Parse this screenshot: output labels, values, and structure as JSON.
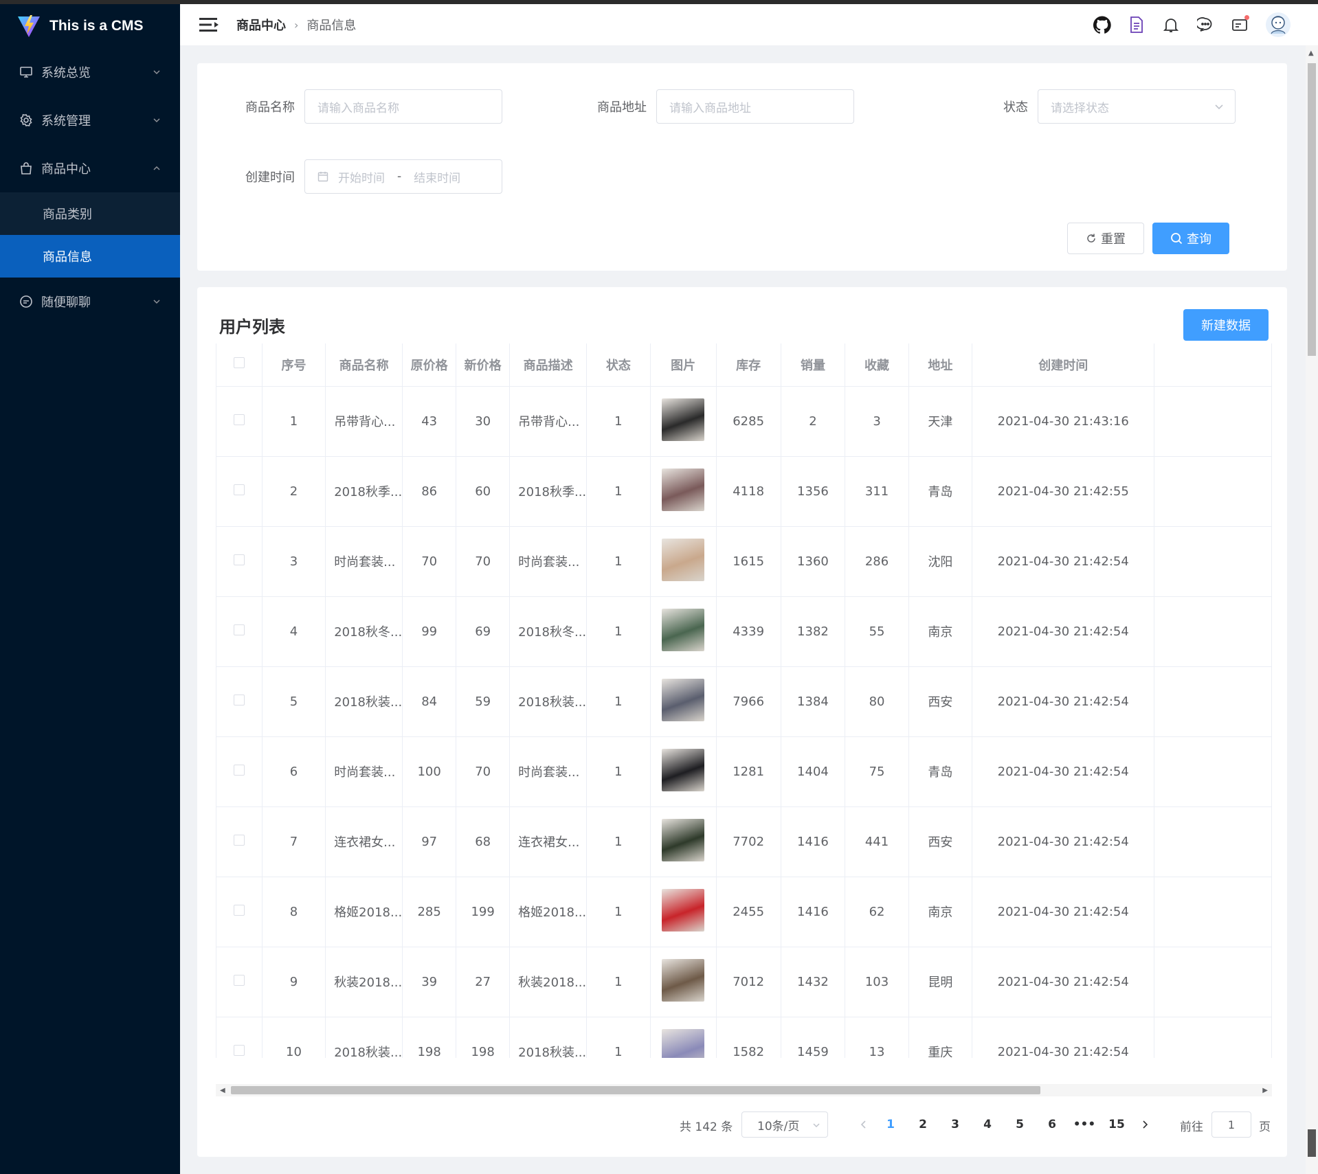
{
  "app": {
    "title": "This is a CMS",
    "brand_color": "#409eff",
    "sidebar_bg": "#001529",
    "active_bg": "#0a60bd"
  },
  "sidebar": {
    "items": [
      {
        "label": "系统总览",
        "icon": "monitor-icon"
      },
      {
        "label": "系统管理",
        "icon": "gear-icon"
      },
      {
        "label": "商品中心",
        "icon": "shopping-bag-icon",
        "expanded": true
      },
      {
        "label": "随便聊聊",
        "icon": "chat-icon"
      }
    ],
    "sub_items": [
      {
        "label": "商品类别"
      },
      {
        "label": "商品信息",
        "active": true
      }
    ]
  },
  "header": {
    "breadcrumb": [
      "商品中心",
      "商品信息"
    ],
    "icons": [
      "github-icon",
      "document-icon",
      "bell-icon",
      "message-icon",
      "inbox-icon",
      "avatar"
    ]
  },
  "search": {
    "name_label": "商品名称",
    "name_placeholder": "请输入商品名称",
    "address_label": "商品地址",
    "address_placeholder": "请输入商品地址",
    "status_label": "状态",
    "status_placeholder": "请选择状态",
    "created_label": "创建时间",
    "start_placeholder": "开始时间",
    "end_placeholder": "结束时间",
    "date_separator": "-",
    "reset_label": "重置",
    "query_label": "查询"
  },
  "table": {
    "title": "用户列表",
    "new_button": "新建数据",
    "columns": [
      "序号",
      "商品名称",
      "原价格",
      "新价格",
      "商品描述",
      "状态",
      "图片",
      "库存",
      "销量",
      "收藏",
      "地址",
      "创建时间"
    ],
    "rows": [
      {
        "index": "1",
        "name": "吊带背心...",
        "old_price": "43",
        "new_price": "30",
        "desc": "吊带背心...",
        "status": "1",
        "img_color": "#2a2a2a",
        "stock": "6285",
        "sales": "2",
        "favor": "3",
        "address": "天津",
        "created": "2021-04-30 21:43:16"
      },
      {
        "index": "2",
        "name": "2018秋季...",
        "old_price": "86",
        "new_price": "60",
        "desc": "2018秋季...",
        "status": "1",
        "img_color": "#7a5a5a",
        "stock": "4118",
        "sales": "1356",
        "favor": "311",
        "address": "青岛",
        "created": "2021-04-30 21:42:55"
      },
      {
        "index": "3",
        "name": "时尚套装...",
        "old_price": "70",
        "new_price": "70",
        "desc": "时尚套装...",
        "status": "1",
        "img_color": "#c9a88c",
        "stock": "1615",
        "sales": "1360",
        "favor": "286",
        "address": "沈阳",
        "created": "2021-04-30 21:42:54"
      },
      {
        "index": "4",
        "name": "2018秋冬...",
        "old_price": "99",
        "new_price": "69",
        "desc": "2018秋冬...",
        "status": "1",
        "img_color": "#4a6650",
        "stock": "4339",
        "sales": "1382",
        "favor": "55",
        "address": "南京",
        "created": "2021-04-30 21:42:54"
      },
      {
        "index": "5",
        "name": "2018秋装...",
        "old_price": "84",
        "new_price": "59",
        "desc": "2018秋装...",
        "status": "1",
        "img_color": "#5a5e6e",
        "stock": "7966",
        "sales": "1384",
        "favor": "80",
        "address": "西安",
        "created": "2021-04-30 21:42:54"
      },
      {
        "index": "6",
        "name": "时尚套装...",
        "old_price": "100",
        "new_price": "70",
        "desc": "时尚套装...",
        "status": "1",
        "img_color": "#1e1e22",
        "stock": "1281",
        "sales": "1404",
        "favor": "75",
        "address": "青岛",
        "created": "2021-04-30 21:42:54"
      },
      {
        "index": "7",
        "name": "连衣裙女...",
        "old_price": "97",
        "new_price": "68",
        "desc": "连衣裙女...",
        "status": "1",
        "img_color": "#2e3a2a",
        "stock": "7702",
        "sales": "1416",
        "favor": "441",
        "address": "西安",
        "created": "2021-04-30 21:42:54"
      },
      {
        "index": "8",
        "name": "格姬2018...",
        "old_price": "285",
        "new_price": "199",
        "desc": "格姬2018...",
        "status": "1",
        "img_color": "#c8242a",
        "stock": "2455",
        "sales": "1416",
        "favor": "62",
        "address": "南京",
        "created": "2021-04-30 21:42:54"
      },
      {
        "index": "9",
        "name": "秋装2018...",
        "old_price": "39",
        "new_price": "27",
        "desc": "秋装2018...",
        "status": "1",
        "img_color": "#6e5a48",
        "stock": "7012",
        "sales": "1432",
        "favor": "103",
        "address": "昆明",
        "created": "2021-04-30 21:42:54"
      },
      {
        "index": "10",
        "name": "2018秋装...",
        "old_price": "198",
        "new_price": "198",
        "desc": "2018秋装...",
        "status": "1",
        "img_color": "#8a8ab8",
        "stock": "1582",
        "sales": "1459",
        "favor": "13",
        "address": "重庆",
        "created": "2021-04-30 21:42:54"
      }
    ]
  },
  "pagination": {
    "total_text": "共 142 条",
    "page_size": "10条/页",
    "pages": [
      "1",
      "2",
      "3",
      "4",
      "5",
      "6",
      "•••",
      "15"
    ],
    "current": "1",
    "jump_label": "前往",
    "jump_value": "1",
    "jump_unit": "页"
  }
}
